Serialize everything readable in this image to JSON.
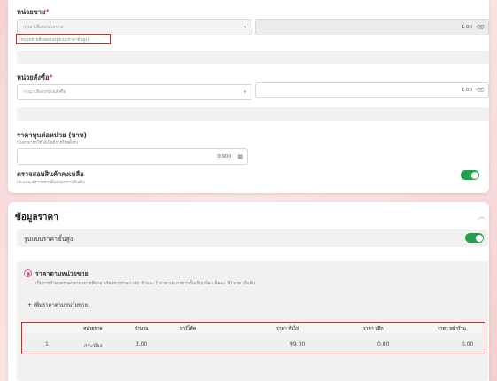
{
  "sell_unit": {
    "label": "หน่วยขาย",
    "required_mark": "*",
    "placeholder": "กรุณาเลือกหน่วยขาย",
    "hint": "(หน่วยขายที่แสดงบนรูปแบบราคาขั้นสูง)",
    "quantity": "1.00"
  },
  "order_unit": {
    "label": "หน่วยสั่งซื้อ",
    "required_mark": "*",
    "placeholder": "กรุณาเลือกหน่วยสั่งซื้อ",
    "quantity": "1.00"
  },
  "cost_per_unit": {
    "label": "ราคาทุนต่อหน่วย (บาท)",
    "hint": "(ไม่สามารถใช้ได้เมื่อมีการใช้สต็อก)",
    "value": "0.000"
  },
  "stock_check": {
    "label": "ตรวจสอบสินค้าคงเหลือ",
    "hint": "(ระบบจะตรวจสอบสต็อกก่อนขายสินค้า)",
    "enabled": true
  },
  "price_section": {
    "title": "ข้อมูลราคา",
    "advanced_price_label": "รูปแบบราคาขั้นสูง",
    "advanced_enabled": true,
    "option_title": "ราคาตามหน่วยขาย",
    "option_desc": "เป็นการกำหนดราคาตามหน่วยที่ขาย พร้อมระบุราคา เช่น ม้วนละ 1 บาท แต่มากกว่านั้นเป็นแพ็ค แพ็คละ 10 บาท เป็นต้น",
    "add_link": "เพิ่มราคาตามหน่วยขาย"
  },
  "price_table": {
    "headers": [
      "",
      "หน่วยขาย",
      "จำนวน",
      "บาร์โค้ด",
      "ราคา ทั่วไป",
      "ราคา ปลีก",
      "ราคา หน้าร้าน"
    ],
    "rows": [
      [
        "1",
        "กระป๋อง",
        "3.00",
        "",
        "99.00",
        "0.00",
        "0.00"
      ]
    ]
  },
  "colors": {
    "accent_green": "#22a14a",
    "annotation_red": "#d92424",
    "radio_pink": "#e0567a"
  }
}
